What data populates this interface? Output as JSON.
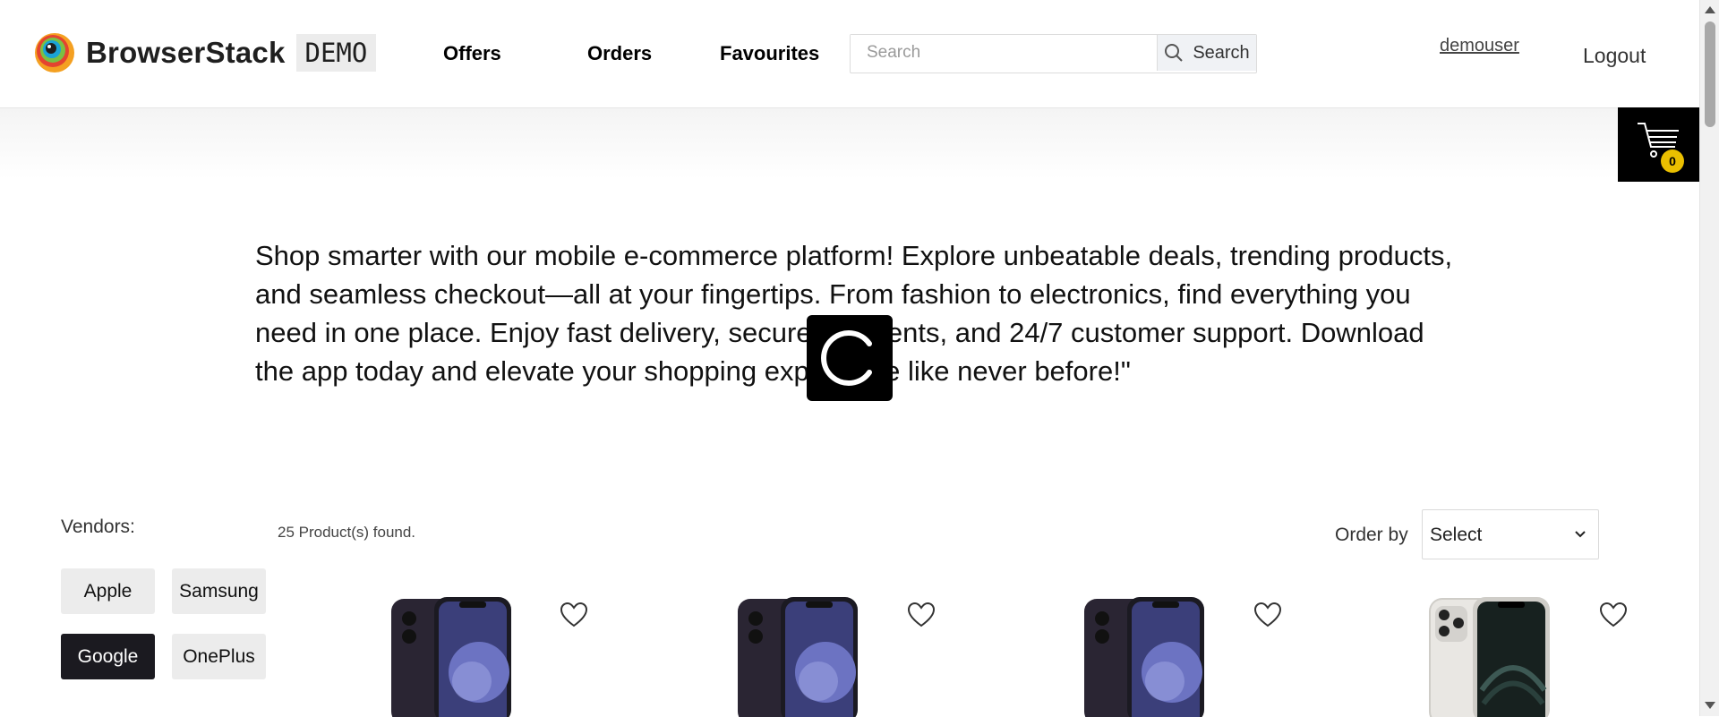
{
  "header": {
    "brand": "BrowserStack",
    "badge": "DEMO",
    "nav": [
      "Offers",
      "Orders",
      "Favourites"
    ],
    "search": {
      "placeholder": "Search",
      "button_label": "Search"
    },
    "user": "demouser",
    "logout": "Logout"
  },
  "cart": {
    "count": "0"
  },
  "intro": "Shop smarter with our mobile e-commerce platform! Explore unbeatable deals, trending products, and seamless checkout—all at your fingertips. From fashion to electronics, find everything you need in one place. Enjoy fast delivery, secure payments, and 24/7 customer support. Download the app today and elevate your shopping experience like never before!\"",
  "filters": {
    "title": "Vendors:",
    "vendors": [
      {
        "label": "Apple",
        "active": false
      },
      {
        "label": "Samsung",
        "active": false
      },
      {
        "label": "Google",
        "active": true
      },
      {
        "label": "OnePlus",
        "active": false
      }
    ]
  },
  "results": {
    "found_text": "25 Product(s) found.",
    "order_by_label": "Order by",
    "order_by_value": "Select"
  },
  "products": [
    {
      "image": "iphone-12-black",
      "favourite": false
    },
    {
      "image": "iphone-12-black",
      "favourite": false
    },
    {
      "image": "iphone-12-black",
      "favourite": false
    },
    {
      "image": "iphone-12-pro-silver",
      "favourite": false
    }
  ],
  "colors": {
    "active_vendor_bg": "#1b1a20",
    "cart_badge": "#eabf00",
    "cart_bg": "#000000"
  }
}
